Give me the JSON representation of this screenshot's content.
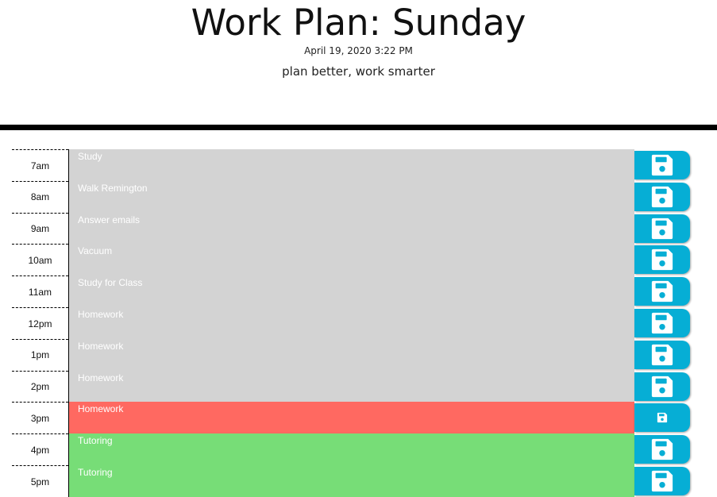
{
  "header": {
    "title": "Work Plan: Sunday",
    "date": "April 19, 2020 3:22 PM",
    "tagline": "plan better, work smarter"
  },
  "colors": {
    "past": "#d3d3d3",
    "present": "#ff6961",
    "future": "#77dd77",
    "save_button": "#06aed5"
  },
  "schedule": [
    {
      "hour": "7am",
      "task": "Study",
      "status": "past",
      "icon": "save-icon"
    },
    {
      "hour": "8am",
      "task": "Walk Remington",
      "status": "past",
      "icon": "save-icon"
    },
    {
      "hour": "9am",
      "task": "Answer emails",
      "status": "past",
      "icon": "save-icon"
    },
    {
      "hour": "10am",
      "task": "Vacuum",
      "status": "past",
      "icon": "save-icon"
    },
    {
      "hour": "11am",
      "task": "Study for Class",
      "status": "past",
      "icon": "save-icon"
    },
    {
      "hour": "12pm",
      "task": "Homework",
      "status": "past",
      "icon": "save-icon"
    },
    {
      "hour": "1pm",
      "task": "Homework",
      "status": "past",
      "icon": "save-icon"
    },
    {
      "hour": "2pm",
      "task": "Homework",
      "status": "past",
      "icon": "save-icon"
    },
    {
      "hour": "3pm",
      "task": "Homework",
      "status": "present",
      "icon": "save-icon"
    },
    {
      "hour": "4pm",
      "task": "Tutoring",
      "status": "future",
      "icon": "save-icon"
    },
    {
      "hour": "5pm",
      "task": "Tutoring",
      "status": "future",
      "icon": "save-icon"
    }
  ]
}
